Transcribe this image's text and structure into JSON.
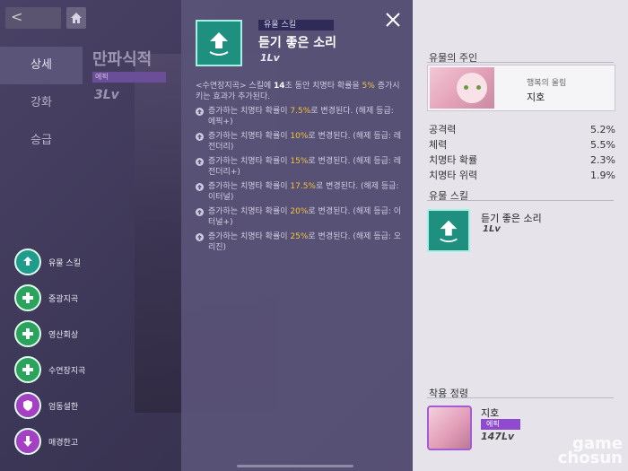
{
  "nav": {
    "back_label": "<"
  },
  "left_tabs": [
    {
      "label": "상세",
      "active": true
    },
    {
      "label": "강화",
      "active": false
    },
    {
      "label": "승급",
      "active": false
    }
  ],
  "background": {
    "title": "만파식적",
    "badge": "에픽",
    "level": "3Lv"
  },
  "skills": [
    {
      "label": "유물 스킬",
      "color": "teal",
      "icon": "arrow-up-icon"
    },
    {
      "label": "중광지곡",
      "color": "green",
      "icon": "cross-icon"
    },
    {
      "label": "영산회상",
      "color": "green",
      "icon": "cross-icon"
    },
    {
      "label": "수연장지곡",
      "color": "green",
      "icon": "cross-icon"
    },
    {
      "label": "엄동설한",
      "color": "purple",
      "icon": "shield-icon"
    },
    {
      "label": "매경한고",
      "color": "purple",
      "icon": "down-arrow-icon"
    }
  ],
  "modal": {
    "tag": "유물 스킬",
    "name": "듣기 좋은 소리",
    "level": "1Lv",
    "desc_intro_a": "<수연장지곡> 스킬에 ",
    "desc_intro_num": "14",
    "desc_intro_b": "초 동안 치명타 확률을 ",
    "desc_intro_pct": "5%",
    "desc_intro_c": " 증가시키는 효과가 추가된다.",
    "upgrades": [
      {
        "pre": "증가하는 치명타 확률이 ",
        "value": "7.5%",
        "post": "로 변경된다. (해제 등급: 에픽+)"
      },
      {
        "pre": "증가하는 치명타 확률이 ",
        "value": "10%",
        "post": "로 변경된다. (해제 등급: 레전더리)"
      },
      {
        "pre": "증가하는 치명타 확률이 ",
        "value": "15%",
        "post": "로 변경된다. (해제 등급: 레전더리+)"
      },
      {
        "pre": "증가하는 치명타 확률이 ",
        "value": "17.5%",
        "post": "로 변경된다. (해제 등급: 이터널)"
      },
      {
        "pre": "증가하는 치명타 확률이 ",
        "value": "20%",
        "post": "로 변경된다. (해제 등급: 이터널+)"
      },
      {
        "pre": "증가하는 치명타 확률이 ",
        "value": "25%",
        "post": "로 변경된다. (해제 등급: 오리진)"
      }
    ]
  },
  "right": {
    "owner_section": "유물의 주인",
    "owner_title": "행복의 울림",
    "owner_name": "지호",
    "stats": [
      {
        "label": "공격력",
        "value": "5.2%"
      },
      {
        "label": "체력",
        "value": "5.5%"
      },
      {
        "label": "치명타 확률",
        "value": "2.3%"
      },
      {
        "label": "치명타 위력",
        "value": "1.9%"
      }
    ],
    "skill_section": "유물 스킬",
    "skill_name": "듣기 좋은 소리",
    "skill_level": "1Lv",
    "equip_section": "착용 정령",
    "equip_name": "지호",
    "equip_badge": "에픽",
    "equip_level": "147Lv"
  },
  "watermark": {
    "line1": "game",
    "line2": "chosun"
  }
}
